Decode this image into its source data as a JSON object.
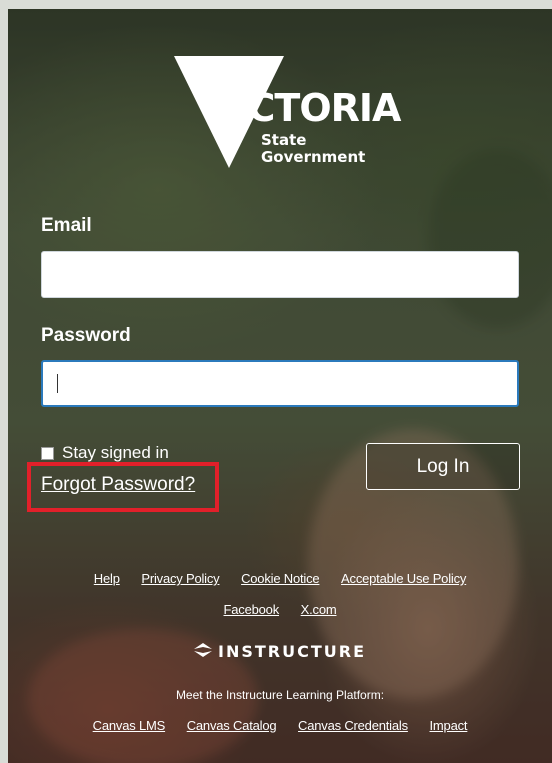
{
  "logo": {
    "wordmark": "VICTORIA",
    "sub_line1": "State",
    "sub_line2": "Government"
  },
  "form": {
    "email_label": "Email",
    "email_value": "",
    "password_label": "Password",
    "password_value": "",
    "stay_signed_in_label": "Stay signed in",
    "stay_signed_in_checked": false,
    "forgot_password_label": "Forgot Password?",
    "login_label": "Log In"
  },
  "footer": {
    "links_row1": [
      "Help",
      "Privacy Policy",
      "Cookie Notice",
      "Acceptable Use Policy"
    ],
    "links_row2": [
      "Facebook",
      "X.com"
    ],
    "brand": "INSTRUCTURE",
    "tagline": "Meet the Instructure Learning Platform:",
    "links_row3": [
      "Canvas LMS",
      "Canvas Catalog",
      "Canvas Credentials",
      "Impact"
    ]
  },
  "colors": {
    "highlight_box": "#e2202a",
    "focus_border": "#2b7abc"
  }
}
